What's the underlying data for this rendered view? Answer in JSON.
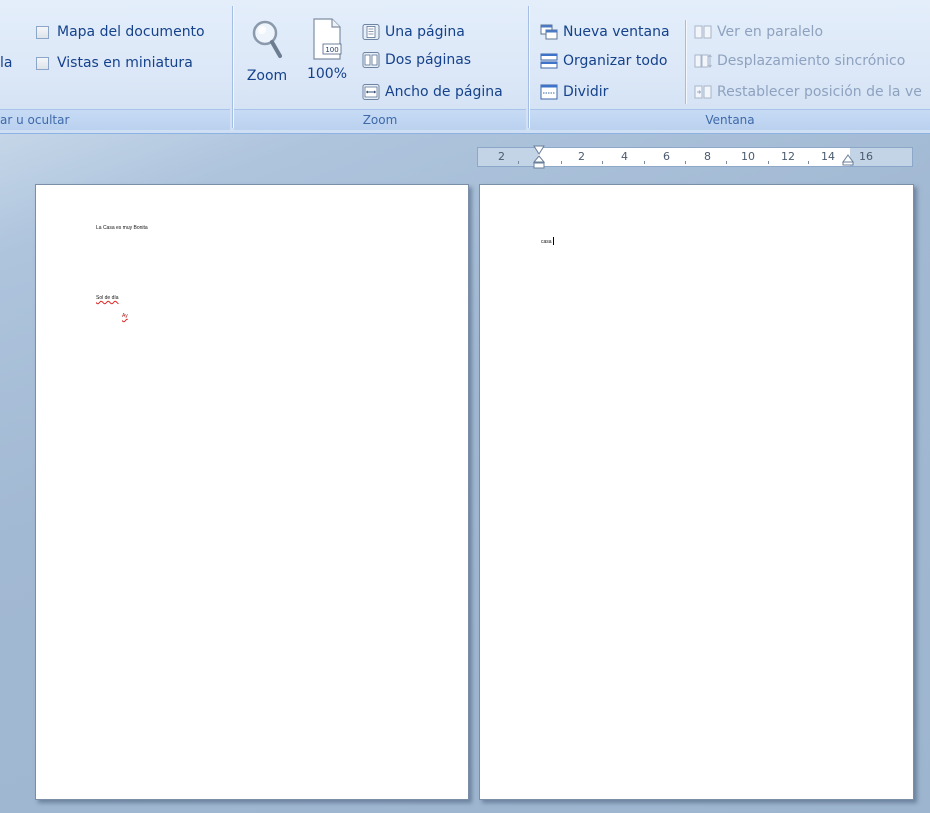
{
  "ribbon": {
    "show_hide": {
      "truncated_left": "la",
      "document_map": "Mapa del documento",
      "thumbnails": "Vistas en miniatura",
      "group_label": "ar u ocultar"
    },
    "zoom": {
      "zoom_label": "Zoom",
      "percent_label": "100%",
      "percent_icon_text": "100",
      "one_page": "Una página",
      "two_pages": "Dos páginas",
      "page_width": "Ancho de página",
      "group_label": "Zoom"
    },
    "window": {
      "new_window": "Nueva ventana",
      "arrange_all": "Organizar todo",
      "split": "Dividir",
      "side_by_side": "Ver en paralelo",
      "sync_scroll": "Desplazamiento sincrónico",
      "reset_position": "Restablecer posición de la ve",
      "group_label": "Ventana"
    }
  },
  "ruler": {
    "labels": [
      "2",
      "2",
      "4",
      "6",
      "8",
      "10",
      "12",
      "14",
      "16"
    ]
  },
  "pages": {
    "left": {
      "line1": "La Casa es muy Bonita",
      "line2": "Sol de día",
      "line3": "Ay"
    },
    "right": {
      "line1": "casa"
    }
  },
  "colors": {
    "ribbon_text": "#15428b",
    "ribbon_bg": "#dbe7f7",
    "workspace_bg": "#a2b9d3",
    "spelling_error": "#e02020"
  }
}
